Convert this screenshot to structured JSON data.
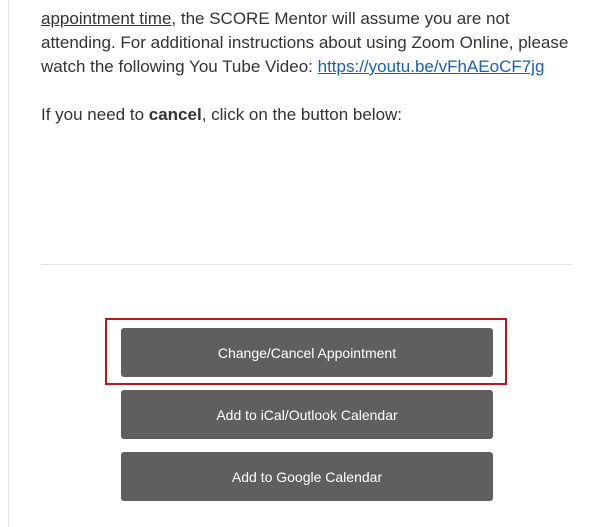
{
  "email": {
    "paragraph1": {
      "appointment_time": "appointment time",
      "text_a": ", the SCORE Mentor will assume you are not attending. For additional instructions about using Zoom Online, please watch the following You Tube Video: ",
      "video_link": "https://youtu.be/vFhAEoCF7jg"
    },
    "paragraph2": {
      "prefix": "If you need to ",
      "bold_word": "cancel",
      "suffix": ", click on the button below:"
    }
  },
  "buttons": {
    "change_cancel": "Change/Cancel Appointment",
    "ical_outlook": "Add to iCal/Outlook Calendar",
    "google": "Add to Google Calendar"
  },
  "colors": {
    "button_bg": "#5f5f5f",
    "highlight_border": "#b5171e",
    "link": "#1a5fb4"
  }
}
